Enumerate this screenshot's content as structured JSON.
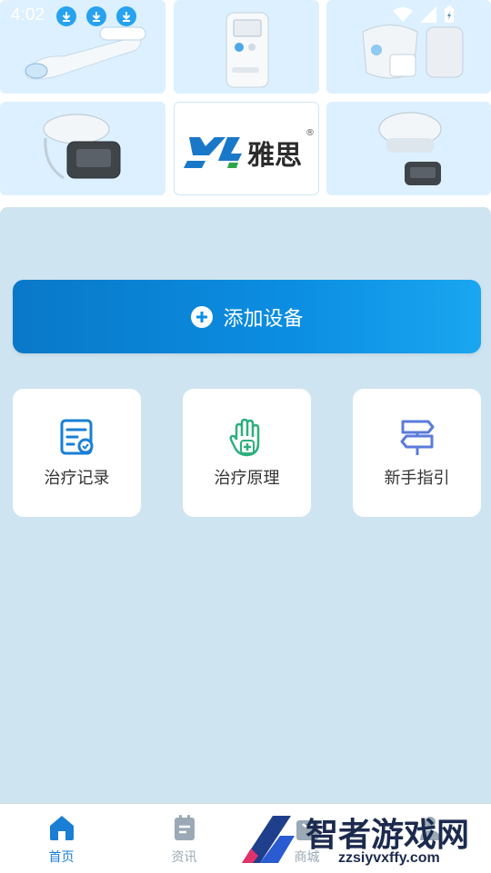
{
  "status_bar": {
    "time": "4:02",
    "download_icons": [
      "download-icon",
      "download-icon",
      "download-icon"
    ],
    "right_icons": [
      "wifi-icon",
      "signal-icon",
      "battery-icon"
    ]
  },
  "banner": {
    "brand_text": "雅思",
    "brand_mark": "YS",
    "registered": "®"
  },
  "main": {
    "add_device_label": "添加设备",
    "cards": [
      {
        "label": "治疗记录",
        "icon": "record-icon"
      },
      {
        "label": "治疗原理",
        "icon": "hand-plus-icon"
      },
      {
        "label": "新手指引",
        "icon": "signpost-icon"
      }
    ]
  },
  "tabbar": {
    "tabs": [
      {
        "label": "首页",
        "icon": "home-icon",
        "active": true
      },
      {
        "label": "资讯",
        "icon": "news-icon",
        "active": false
      },
      {
        "label": "商城",
        "icon": "shop-icon",
        "active": false
      },
      {
        "label": "",
        "icon": "profile-icon",
        "active": false
      }
    ],
    "active_color": "#1a7fd4",
    "inactive_color": "#9aa9b5"
  },
  "watermark": {
    "title": "智者游戏网",
    "url": "zzsiyvxffy.com"
  },
  "colors": {
    "accent": "#0b8ee2",
    "background": "#cfe4f1",
    "tile": "#dcf0ff"
  }
}
